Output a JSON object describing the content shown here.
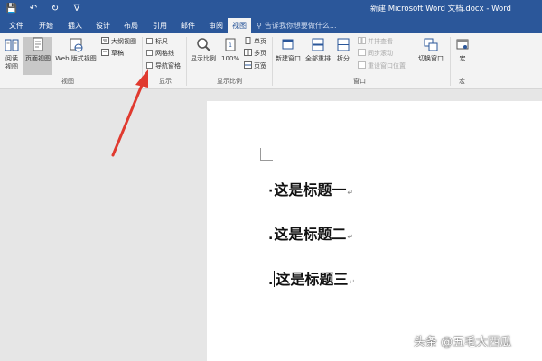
{
  "window": {
    "title": "新建 Microsoft Word 文档.docx - Word",
    "qat": {
      "save_icon": "save-icon",
      "undo_icon": "undo-icon",
      "redo_icon": "redo-icon",
      "customize_icon": "customize-qat-icon"
    }
  },
  "tabs": [
    {
      "label": "文件"
    },
    {
      "label": "开始"
    },
    {
      "label": "插入"
    },
    {
      "label": "设计"
    },
    {
      "label": "布局"
    },
    {
      "label": "引用"
    },
    {
      "label": "邮件"
    },
    {
      "label": "审阅"
    },
    {
      "label": "视图",
      "active": true
    }
  ],
  "tell_me": "告诉我你想要做什么...",
  "ribbon": {
    "views": {
      "label": "视图",
      "read_mode": "阅读视图",
      "print_layout": "页面视图",
      "web_layout": "Web 版式视图",
      "outline": "大纲视图",
      "draft": "草稿"
    },
    "show": {
      "label": "显示",
      "ruler": "标尺",
      "gridlines": "网格线",
      "nav_pane": "导航窗格"
    },
    "zoom": {
      "label": "显示比例",
      "zoom_btn": "显示比例",
      "hundred": "100%",
      "one_page": "单页",
      "multi_page": "多页",
      "page_width": "页宽"
    },
    "window": {
      "label": "窗口",
      "new_window": "新建窗口",
      "arrange_all": "全部重排",
      "split": "拆分",
      "side_by_side": "并排查看",
      "sync_scroll": "同步滚动",
      "reset_pos": "重设窗口位置",
      "switch_windows": "切换窗口"
    },
    "macros": {
      "label": "宏",
      "macros_btn": "宏"
    }
  },
  "document": {
    "headings": [
      "这是标题一",
      "这是标题二",
      "这是标题三"
    ],
    "para_mark": "↵"
  },
  "watermark": "头条 @五毛大西瓜",
  "colors": {
    "accent": "#2b579a",
    "arrow": "#e03a2f"
  }
}
